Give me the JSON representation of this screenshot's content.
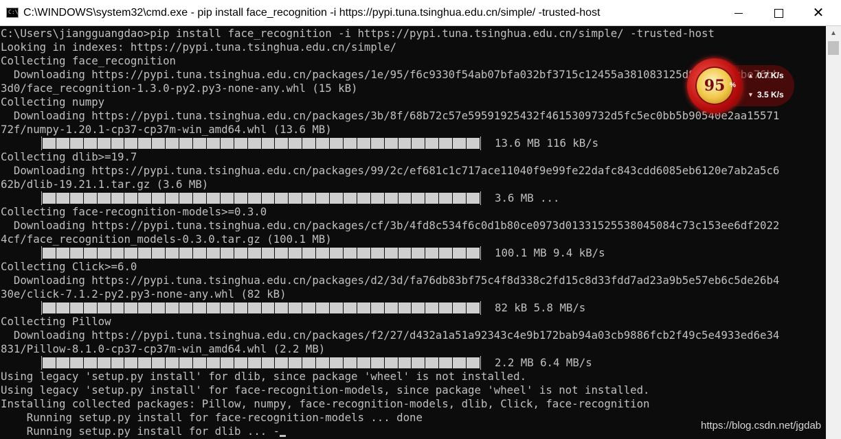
{
  "window": {
    "icon_text": "C:\\.",
    "title": "C:\\WINDOWS\\system32\\cmd.exe - pip  install face_recognition -i https://pypi.tuna.tsinghua.edu.cn/simple/ -trusted-host",
    "minimize_icon": "minimize-icon",
    "maximize_icon": "maximize-icon",
    "close_icon": "close-icon"
  },
  "console": {
    "lines": [
      "C:\\Users\\jiangguangdao>pip install face_recognition -i https://pypi.tuna.tsinghua.edu.cn/simple/ -trusted-host",
      "Looking in indexes: https://pypi.tuna.tsinghua.edu.cn/simple/",
      "Collecting face_recognition",
      "  Downloading https://pypi.tuna.tsinghua.edu.cn/packages/1e/95/f6c9330f54ab07bfa032bf3715c12455a381083125d8880c43cbe76bb",
      "3d0/face_recognition-1.3.0-py2.py3-none-any.whl (15 kB)",
      "Collecting numpy",
      "  Downloading https://pypi.tuna.tsinghua.edu.cn/packages/3b/8f/68b72c57e59591925432f4615309732d5fc5ec0bb5b90540e2aa15571",
      "72f/numpy-1.20.1-cp37-cp37m-win_amd64.whl (13.6 MB)",
      "",
      "Collecting dlib>=19.7",
      "  Downloading https://pypi.tuna.tsinghua.edu.cn/packages/99/2c/ef681c1c717ace11040f9e99fe22dafc843cdd6085eb6120e7ab2a5c6",
      "62b/dlib-19.21.1.tar.gz (3.6 MB)",
      "",
      "Collecting face-recognition-models>=0.3.0",
      "  Downloading https://pypi.tuna.tsinghua.edu.cn/packages/cf/3b/4fd8c534f6c0d1b80ce0973d01331525538045084c73c153ee6df2022",
      "4cf/face_recognition_models-0.3.0.tar.gz (100.1 MB)",
      "",
      "Collecting Click>=6.0",
      "  Downloading https://pypi.tuna.tsinghua.edu.cn/packages/d2/3d/fa76db83bf75c4f8d338c2fd15c8d33fdd7ad23a9b5e57eb6c5de26b4",
      "30e/click-7.1.2-py2.py3-none-any.whl (82 kB)",
      "",
      "Collecting Pillow",
      "  Downloading https://pypi.tuna.tsinghua.edu.cn/packages/f2/27/d432a1a51a92343c4e9b172bab94a03cb9886fcb2f49c5e4933ed6e34",
      "831/Pillow-8.1.0-cp37-cp37m-win_amd64.whl (2.2 MB)",
      "",
      "Using legacy 'setup.py install' for dlib, since package 'wheel' is not installed.",
      "Using legacy 'setup.py install' for face-recognition-models, since package 'wheel' is not installed.",
      "Installing collected packages: Pillow, numpy, face-recognition-models, dlib, Click, face-recognition",
      "    Running setup.py install for face-recognition-models ... done",
      "    Running setup.py install for dlib ... -"
    ],
    "progress_bars": [
      {
        "label": "13.6 MB 116 kB/s",
        "fraction": 1.0
      },
      {
        "label": "3.6 MB ...",
        "fraction": 1.0
      },
      {
        "label": "100.1 MB 9.4 kB/s",
        "fraction": 1.0
      },
      {
        "label": "82 kB 5.8 MB/s",
        "fraction": 1.0
      },
      {
        "label": "2.2 MB 6.4 MB/s",
        "fraction": 1.0
      }
    ]
  },
  "widget": {
    "percent": "95",
    "percent_sign": "%",
    "upload_speed": "0.7 K/s",
    "download_speed": "3.5 K/s"
  },
  "watermark": "https://blog.csdn.net/jgdab",
  "colors": {
    "console_bg": "#0c0c0c",
    "console_text": "#c0c0c0",
    "titlebar_bg": "#ffffff"
  }
}
